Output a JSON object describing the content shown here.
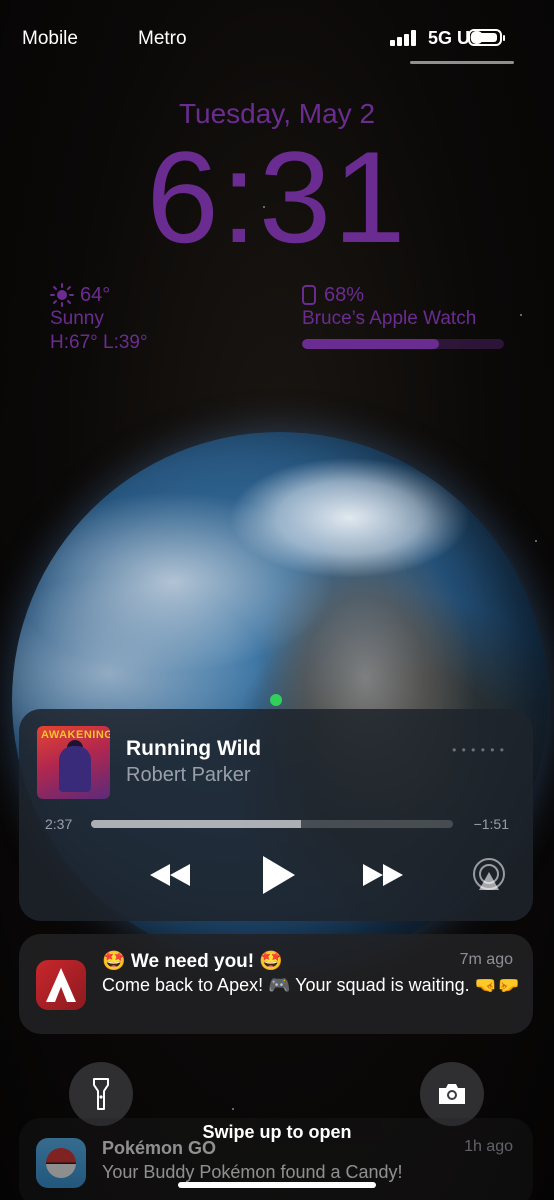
{
  "status_bar": {
    "carrier_1": "Mobile",
    "carrier_2": "Metro",
    "network": "5G UC",
    "battery_icon": "battery-full-icon",
    "signal_icon": "cellular-signal-icon"
  },
  "lock_screen": {
    "date": "Tuesday, May 2",
    "time": "6:31",
    "accent_color": "#6b2c91"
  },
  "weather_widget": {
    "icon": "sun-icon",
    "temperature": "64°",
    "condition": "Sunny",
    "high_low": "H:67° L:39°"
  },
  "watch_widget": {
    "icon": "apple-watch-icon",
    "percent": "68%",
    "device_name": "Bruce’s Apple Watch",
    "level": 0.68
  },
  "now_playing": {
    "album_art_text": "AWAKENING",
    "title": "Running Wild",
    "artist": "Robert Parker",
    "elapsed": "2:37",
    "remaining": "−1:51",
    "progress": 0.58,
    "controls": [
      "rewind-icon",
      "play-icon",
      "fast-forward-icon",
      "airplay-icon"
    ]
  },
  "notifications": [
    {
      "app_icon": "apex-legends-icon",
      "title": "🤩 We need you! 🤩",
      "time": "7m ago",
      "body": "Come back to Apex! 🎮 Your squad is waiting. 🤜🤛"
    },
    {
      "app_icon": "pokemon-go-icon",
      "title": "Pokémon GO",
      "time": "1h ago",
      "body": "Your Buddy Pokémon found a Candy!"
    }
  ],
  "quick_actions": [
    "flashlight-icon",
    "camera-icon"
  ],
  "swipe_hint": "Swipe up to open"
}
